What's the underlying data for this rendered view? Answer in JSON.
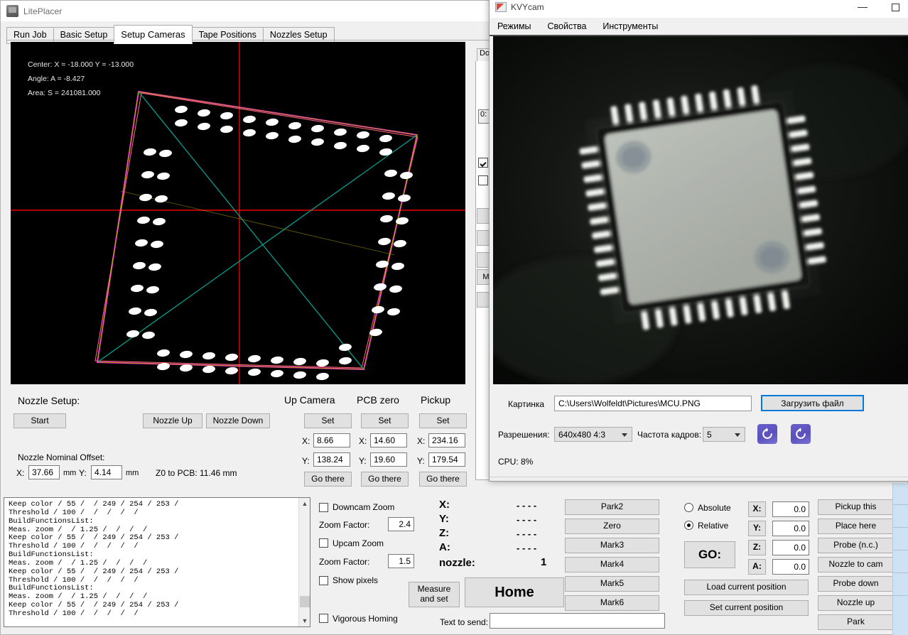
{
  "liteplacer": {
    "title": "LitePlacer",
    "window_controls": {
      "minimize": "minimize-icon",
      "maximize": "maximize-icon"
    },
    "tabs": [
      {
        "label": "Run Job",
        "active": false
      },
      {
        "label": "Basic Setup",
        "active": false
      },
      {
        "label": "Setup Cameras",
        "active": true
      },
      {
        "label": "Tape Positions",
        "active": false
      },
      {
        "label": "Nozzles Setup",
        "active": false
      }
    ],
    "vision_overlay": {
      "center": "Center: X = -18.000 Y = -13.000",
      "angle": "Angle: A =  -8.427",
      "area": "Area: S =  241081.000",
      "colors": {
        "outline": "#ff00ff",
        "diagonal": "#009b8f",
        "secondary": "#b8a800",
        "crosshair": "#ff0000",
        "fit": "#ff6a6a",
        "background": "#000000"
      }
    },
    "right_column": {
      "tab_label": "Do",
      "field_value": "0:",
      "button_label": "M"
    },
    "nozzle_setup": {
      "heading": "Nozzle Setup:",
      "start_button": "Start",
      "nozzle_up_button": "Nozzle Up",
      "nozzle_down_button": "Nozzle Down",
      "nominal_offset_label": "Nozzle Nominal Offset:",
      "x_label": "X:",
      "x_value": "37.66",
      "x_unit": "mm",
      "y_label": "Y:",
      "y_value": "4.14",
      "y_unit": "mm",
      "z0_to_pcb": "Z0 to PCB:   11.46 mm"
    },
    "position_groups": [
      {
        "title": "Up Camera",
        "set": "Set",
        "x_label": "X:",
        "x": "8.66",
        "y_label": "Y:",
        "y": "138.24",
        "go": "Go there"
      },
      {
        "title": "PCB zero",
        "set": "Set",
        "x_label": "X:",
        "x": "14.60",
        "y_label": "Y:",
        "y": "19.60",
        "go": "Go there"
      },
      {
        "title": "Pickup",
        "set": "Set",
        "x_label": "X:",
        "x": "234.16",
        "y_label": "Y:",
        "y": "179.54",
        "go": "Go there"
      }
    ],
    "log": "Keep color / 55 /  / 249 / 254 / 253 /\nThreshold / 100 /  /  /  /  /\nBuildFunctionsList:\nMeas. zoom /  / 1.25 /  /  /  /\nKeep color / 55 /  / 249 / 254 / 253 /\nThreshold / 100 /  /  /  /  /\nBuildFunctionsList:\nMeas. zoom /  / 1.25 /  /  /  /\nKeep color / 55 /  / 249 / 254 / 253 /\nThreshold / 100 /  /  /  /  /\nBuildFunctionsList:\nMeas. zoom /  / 1.25 /  /  /  /\nKeep color / 55 /  / 249 / 254 / 253 /\nThreshold / 100 /  /  /  /  /",
    "zoom_controls": {
      "downcam_zoom_label": "Downcam Zoom",
      "downcam_zoom_checked": false,
      "downcam_factor_label": "Zoom Factor:",
      "downcam_factor_value": "2.4",
      "upcam_zoom_label": "Upcam Zoom",
      "upcam_zoom_checked": false,
      "upcam_factor_label": "Zoom Factor:",
      "upcam_factor_value": "1.5",
      "show_pixels_label": "Show pixels",
      "show_pixels_checked": false,
      "vigorous_homing_label": "Vigorous Homing",
      "vigorous_homing_checked": false
    },
    "readout": {
      "x_label": "X:",
      "x_value": "- - - -",
      "y_label": "Y:",
      "y_value": "- - - -",
      "z_label": "Z:",
      "z_value": "- - - -",
      "a_label": "A:",
      "a_value": "- - - -",
      "nozzle_label": "nozzle:",
      "nozzle_value": "1"
    },
    "actions": {
      "measure_and_set": "Measure\nand set",
      "home": "Home",
      "text_to_send_label": "Text to send:",
      "text_to_send_value": ""
    },
    "park_buttons": [
      "Park2",
      "Zero",
      "Mark3",
      "Mark4",
      "Mark5",
      "Mark6"
    ],
    "move_mode": {
      "absolute_label": "Absolute",
      "relative_label": "Relative",
      "selected": "Relative"
    },
    "go_panel": {
      "go_label": "GO:",
      "load_current_position": "Load current position",
      "set_current_position": "Set current position",
      "axes": [
        {
          "label": "X:",
          "value": "0.0"
        },
        {
          "label": "Y:",
          "value": "0.0"
        },
        {
          "label": "Z:",
          "value": "0.0"
        },
        {
          "label": "A:",
          "value": "0.0"
        }
      ]
    },
    "right_buttons": [
      "Pickup this",
      "Place here",
      "Probe (n.c.)",
      "Nozzle to cam",
      "Probe down",
      "Nozzle up",
      "Park"
    ]
  },
  "kvycam": {
    "title": "KVYcam",
    "window_controls": {
      "minimize": "minimize-icon",
      "maximize": "maximize-icon"
    },
    "menu": [
      "Режимы",
      "Свойства",
      "Инструменты"
    ],
    "picture_label": "Картинка",
    "picture_path": "C:\\Users\\Wolfeldt\\Pictures\\MCU.PNG",
    "load_file_button": "Загрузить файл",
    "resolution_label": "Разрешения:",
    "resolution_value": "640x480  4:3",
    "framerate_label": "Частота кадров:",
    "framerate_value": "5",
    "cpu_label": "CPU: 8%",
    "refresh_icons": [
      "rotate-left-icon",
      "rotate-right-icon"
    ],
    "accent_color": "#0078d7",
    "refresh_button_color": "#6257c4"
  }
}
